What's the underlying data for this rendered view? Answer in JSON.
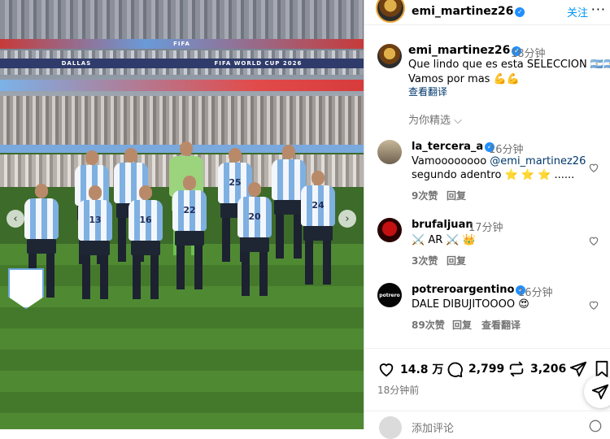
{
  "photo": {
    "banners": {
      "top": "FIFA",
      "mid_left": "DALLAS",
      "mid_right": "FIFA WORLD CUP 2026"
    },
    "players_back": [
      {
        "number": ""
      },
      {
        "number": ""
      },
      {
        "number": ""
      },
      {
        "number": "25"
      },
      {
        "number": ""
      }
    ],
    "players_front": [
      {
        "number": ""
      },
      {
        "number": "13"
      },
      {
        "number": "16"
      },
      {
        "number": "22"
      },
      {
        "number": "20"
      },
      {
        "number": "24"
      }
    ]
  },
  "header": {
    "username": "emi_martinez26",
    "follow_label": "关注",
    "more_label": "···"
  },
  "caption": {
    "username": "emi_martinez26",
    "time": "18分钟",
    "line1": "Que lindo que es esta SELECCION 🇦🇷🇦🇷",
    "line2": "Vamos por mas 💪💪",
    "translate": "查看翻译"
  },
  "filter": {
    "label": "为你精选"
  },
  "comments": [
    {
      "username": "la_tercera_a",
      "time": "16分钟",
      "text_pre": "Vamoooooooo ",
      "mention": "@emi_martinez26",
      "text_line2": "segundo adentro ⭐ ⭐ ⭐ ......",
      "likes": "9次赞",
      "reply": "回复",
      "translate": ""
    },
    {
      "username": "brufaljuan",
      "time": "17分钟",
      "text_pre": "⚔️ AR ⚔️ 👑",
      "mention": "",
      "text_line2": "",
      "likes": "3次赞",
      "reply": "回复",
      "translate": ""
    },
    {
      "username": "potreroargentino",
      "time": "16分钟",
      "text_pre": "DALE DIBUJITOOOO 😍",
      "mention": "",
      "text_line2": "",
      "likes": "89次赞",
      "reply": "回复",
      "translate": "查看翻译",
      "avatar_text": "potrero"
    }
  ],
  "stats": {
    "likes": "14.8 万",
    "comments": "2,799",
    "reposts": "3,206",
    "posted": "18分钟前"
  },
  "add_comment": {
    "placeholder": "添加评论"
  },
  "colors": {
    "accent": "#0095f6",
    "verified": "#1f8fff",
    "muted": "#737373"
  }
}
